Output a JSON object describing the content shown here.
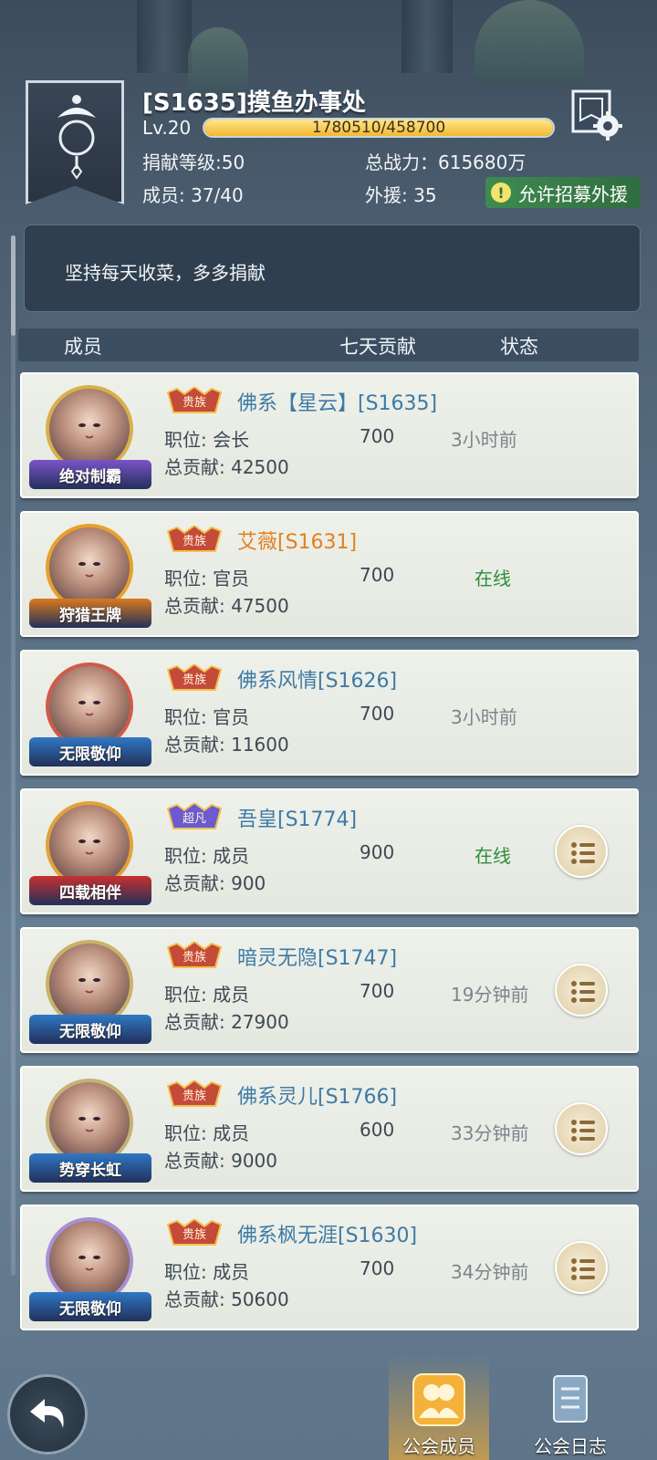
{
  "guild": {
    "name": "[S1635]摸鱼办事处",
    "level": "Lv.20",
    "xp_text": "1780510/458700",
    "xp_fraction": 1.0,
    "donate_level": "捐献等级:50",
    "total_power": "总战力：615680万",
    "members": "成员: 37/40",
    "foreign_aid": "外援: 35",
    "recruit_label": "允许招募外援",
    "notice": "坚持每天收菜，多多捐献"
  },
  "columns": {
    "member": "成员",
    "week": "七天贡献",
    "status": "状态"
  },
  "members": [
    {
      "name": "佛系【星云】[S1635]",
      "position": "职位: 会长",
      "week": "700",
      "status": "3小时前",
      "total": "总贡献: 42500",
      "title": "绝对制霸",
      "vip": "贵族",
      "online": false,
      "menu": false
    },
    {
      "name": "艾薇[S1631]",
      "position": "职位: 官员",
      "week": "700",
      "status": "在线",
      "total": "总贡献: 47500",
      "title": "狩猎王牌",
      "vip": "贵族",
      "online": true,
      "menu": false
    },
    {
      "name": "佛系风情[S1626]",
      "position": "职位: 官员",
      "week": "700",
      "status": "3小时前",
      "total": "总贡献: 11600",
      "title": "无限敬仰",
      "vip": "贵族",
      "online": false,
      "menu": false
    },
    {
      "name": "吾皇[S1774]",
      "position": "职位: 成员",
      "week": "900",
      "status": "在线",
      "total": "总贡献: 900",
      "title": "四载相伴",
      "vip": "超凡",
      "online": true,
      "menu": true
    },
    {
      "name": "暗灵无隐[S1747]",
      "position": "职位: 成员",
      "week": "700",
      "status": "19分钟前",
      "total": "总贡献: 27900",
      "title": "无限敬仰",
      "vip": "贵族",
      "online": false,
      "menu": true
    },
    {
      "name": "佛系灵儿[S1766]",
      "position": "职位: 成员",
      "week": "600",
      "status": "33分钟前",
      "total": "总贡献: 9000",
      "title": "势穿长虹",
      "vip": "贵族",
      "online": false,
      "menu": true
    },
    {
      "name": "佛系枫无涯[S1630]",
      "position": "职位: 成员",
      "week": "700",
      "status": "34分钟前",
      "total": "总贡献: 50600",
      "title": "无限敬仰",
      "vip": "贵族",
      "online": false,
      "menu": true
    }
  ],
  "tabs": {
    "members": "公会成员",
    "log": "公会日志"
  },
  "colors": {
    "name_blue": "#3e7aa6",
    "name_orange": "#e3801f",
    "online_green": "#2f8c3c",
    "xp_gold": "#f3b832"
  }
}
